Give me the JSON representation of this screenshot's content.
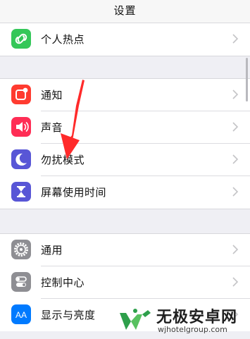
{
  "nav": {
    "title": "设置"
  },
  "groups": [
    {
      "rows": [
        {
          "label": "个人热点",
          "icon": "hotspot-icon",
          "color": "#34c759"
        }
      ]
    },
    {
      "rows": [
        {
          "label": "通知",
          "icon": "notifications-icon",
          "color": "#ff3b30"
        },
        {
          "label": "声音",
          "icon": "sounds-icon",
          "color": "#ff2d55"
        },
        {
          "label": "勿扰模式",
          "icon": "moon-icon",
          "color": "#5856d6"
        },
        {
          "label": "屏幕使用时间",
          "icon": "hourglass-icon",
          "color": "#5856d6"
        }
      ]
    },
    {
      "rows": [
        {
          "label": "通用",
          "icon": "gear-icon",
          "color": "#8e8e93"
        },
        {
          "label": "控制中心",
          "icon": "toggles-icon",
          "color": "#8e8e93"
        },
        {
          "label": "显示与亮度",
          "icon": "display-brightness-icon",
          "color": "#007aff"
        }
      ]
    }
  ],
  "annotation": {
    "icon": "red-arrow-pointer",
    "color": "#ff2a2a"
  },
  "watermark": {
    "title": "无极安卓网",
    "url": "wjhotelgroup.com"
  }
}
